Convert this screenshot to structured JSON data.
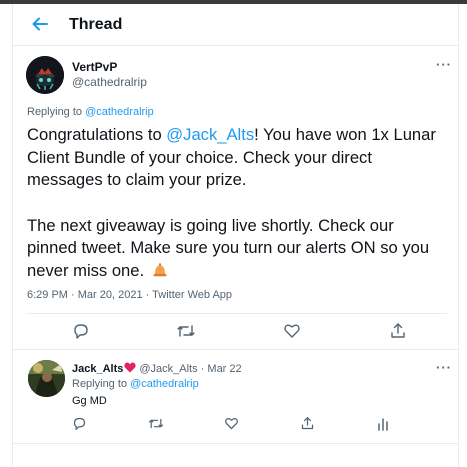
{
  "header": {
    "title": "Thread"
  },
  "main_tweet": {
    "display_name": "VertPvP",
    "handle": "@cathedralrip",
    "replying_prefix": "Replying to ",
    "replying_to": "@cathedralrip",
    "text_lines": [
      [
        "Congratulations to ",
        "@Jack_Alts",
        "! You have won 1x Lunar"
      ],
      "Client Bundle of your choice. Check your direct",
      "messages to claim your prize.",
      "The next giveaway is going live shortly. Check our",
      "pinned tweet. Make sure you turn our alerts ON so you",
      "never miss one. "
    ],
    "meta": "6:29 PM · Mar 20, 2021 · Twitter Web App",
    "more": "···"
  },
  "reply_tweet": {
    "display_name": "Jack_Alts",
    "handle": "@Jack_Alts",
    "date": " · Mar 22",
    "replying_prefix": "Replying to ",
    "replying_to": "@cathedralrip",
    "text": "Gg MD",
    "more": "···"
  },
  "colors": {
    "accent": "#1d9bf0",
    "text": "#0f1419",
    "muted": "#536471",
    "border": "#e6ecf0"
  },
  "icons": [
    "back-arrow-icon",
    "more-icon",
    "reply-icon",
    "retweet-icon",
    "like-icon",
    "share-icon",
    "analytics-icon",
    "bell-icon",
    "heart-emoji-icon"
  ]
}
